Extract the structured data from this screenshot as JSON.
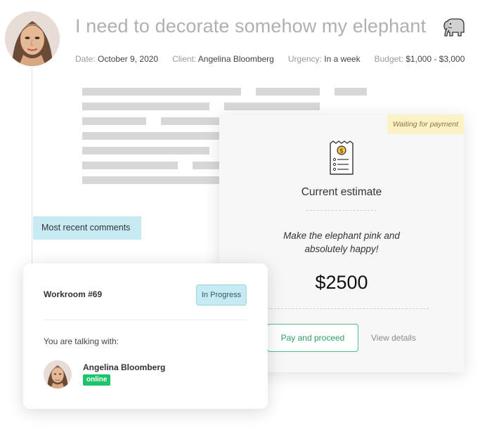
{
  "header": {
    "title": "I need to decorate somehow my elephant",
    "title_icon": "elephant-icon",
    "meta": [
      {
        "key": "Date:",
        "value": "October 9, 2020"
      },
      {
        "key": "Client:",
        "value": "Angelina Bloomberg"
      },
      {
        "key": "Urgency:",
        "value": "In a week"
      },
      {
        "key": "Budget:",
        "value": "$1,000 - $3,000"
      }
    ]
  },
  "comments": {
    "label": "Most recent comments"
  },
  "estimate": {
    "status": "Waiting for payment",
    "icon": "receipt-icon",
    "title": "Current estimate",
    "description": "Make the elephant pink and absolutely happy!",
    "amount": "$2500",
    "pay_label": "Pay and proceed",
    "details_label": "View details"
  },
  "workroom": {
    "title": "Workroom #69",
    "status": "In Progress",
    "talking_label": "You are talking with:",
    "contact_name": "Angelina Bloomberg",
    "contact_status": "online"
  },
  "colors": {
    "accent_green": "#4fbf88",
    "online_green": "#1fc46a",
    "badge_blue": "#c8eaf3",
    "waiting_yellow": "#fdf1c6"
  }
}
